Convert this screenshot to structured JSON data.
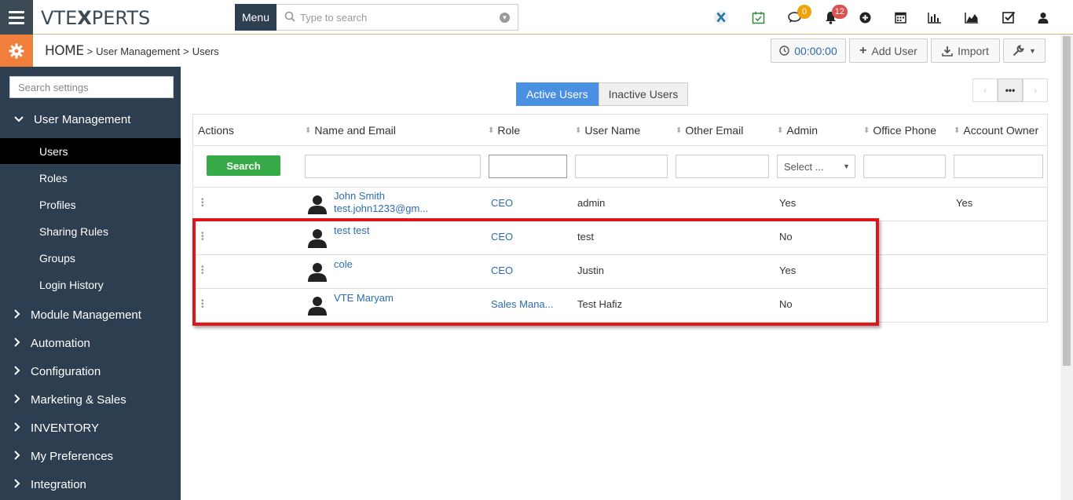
{
  "app": {
    "logo_text": "VTEXPERTS"
  },
  "topbar": {
    "menu_label": "Menu",
    "search_placeholder": "Type to search",
    "chat_badge": "0",
    "notification_badge": "12"
  },
  "breadcrumb": {
    "home": "HOME",
    "sep1": ">",
    "section": "User Management",
    "sep2": ">",
    "page": "Users"
  },
  "toolbar": {
    "timer": "00:00:00",
    "add_user": "Add User",
    "import": "Import"
  },
  "sidebar": {
    "search_placeholder": "Search settings",
    "open_section": "User Management",
    "sub_items": [
      "Users",
      "Roles",
      "Profiles",
      "Sharing Rules",
      "Groups",
      "Login History"
    ],
    "sections": [
      "Module Management",
      "Automation",
      "Configuration",
      "Marketing & Sales",
      "INVENTORY",
      "My Preferences",
      "Integration"
    ]
  },
  "tabs": {
    "active": "Active Users",
    "inactive": "Inactive Users"
  },
  "pager": {
    "more": "•••"
  },
  "table": {
    "headers": [
      "Actions",
      "Name and Email",
      "Role",
      "User Name",
      "Other Email",
      "Admin",
      "Office Phone",
      "Account Owner"
    ],
    "search_button": "Search",
    "admin_select_placeholder": "Select ...",
    "rows": [
      {
        "name": "John Smith",
        "email": "test.john1233@gm...",
        "role": "CEO",
        "username": "admin",
        "admin": "Yes",
        "account_owner": "Yes"
      },
      {
        "name": "test test",
        "email": "",
        "role": "CEO",
        "username": "test",
        "admin": "No",
        "account_owner": ""
      },
      {
        "name": "cole",
        "email": "",
        "role": "CEO",
        "username": "Justin",
        "admin": "Yes",
        "account_owner": ""
      },
      {
        "name": "VTE Maryam",
        "email": "",
        "role": "Sales Mana...",
        "username": "Test Hafiz",
        "admin": "No",
        "account_owner": ""
      }
    ]
  },
  "colors": {
    "accent": "#4a90e2",
    "sidebar_bg": "#2d3e50",
    "search_green": "#35aa47",
    "highlight_red": "#e0141b",
    "gear_orange": "#f07f3c"
  }
}
